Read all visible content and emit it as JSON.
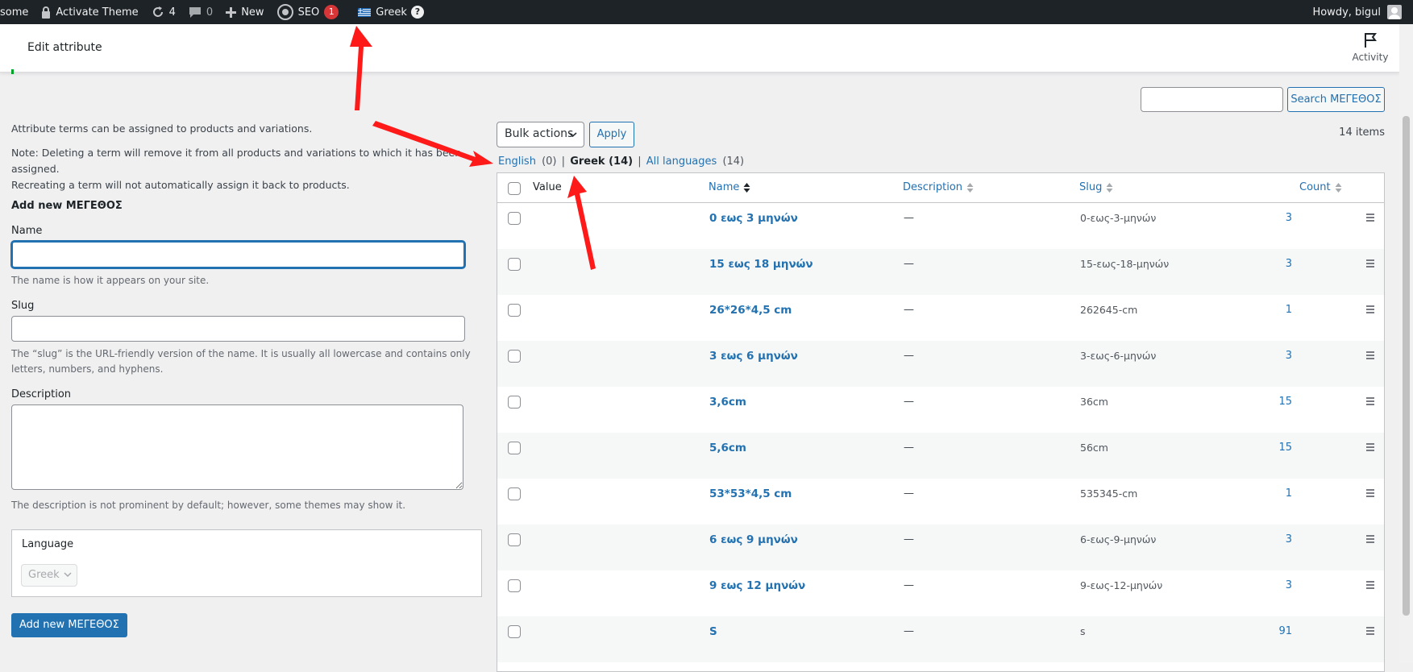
{
  "adminbar": {
    "site_label": "some",
    "activate_theme": "Activate Theme",
    "updates_count": "4",
    "comments_count": "0",
    "new_label": "New",
    "seo_label": "SEO",
    "seo_badge": "1",
    "language_label": "Greek",
    "language_help": "?",
    "howdy": "Howdy, bigul"
  },
  "header": {
    "title": "Edit attribute",
    "activity_label": "Activity"
  },
  "form": {
    "intro": "Attribute terms can be assigned to products and variations.",
    "note_line1": "Note: Deleting a term will remove it from all products and variations to which it has been assigned.",
    "note_line2": "Recreating a term will not automatically assign it back to products.",
    "title": "Add new ΜΕΓΕΘΟΣ",
    "name_label": "Name",
    "name_hint": "The name is how it appears on your site.",
    "slug_label": "Slug",
    "slug_hint_line1": "The “slug” is the URL-friendly version of the name. It is usually all lowercase and contains only",
    "slug_hint_line2": "letters, numbers, and hyphens.",
    "description_label": "Description",
    "description_hint": "The description is not prominent by default; however, some themes may show it.",
    "language_label": "Language",
    "language_value": "Greek",
    "submit_label": "Add new ΜΕΓΕΘΟΣ"
  },
  "list": {
    "search_button": "Search ΜΕΓΕΘΟΣ",
    "bulk_actions": "Bulk actions",
    "apply": "Apply",
    "items_count": "14 items",
    "filters": {
      "english": "English",
      "english_count": "(0)",
      "greek": "Greek",
      "greek_count": "(14)",
      "all": "All languages",
      "all_count": "(14)",
      "sep": "|"
    },
    "columns": {
      "value": "Value",
      "name": "Name",
      "description": "Description",
      "slug": "Slug",
      "count": "Count"
    },
    "rows": [
      {
        "name": "0 εως 3 μηνών",
        "desc": "—",
        "slug": "0-εως-3-μηνών",
        "count": "3"
      },
      {
        "name": "15 εως 18 μηνών",
        "desc": "—",
        "slug": "15-εως-18-μηνών",
        "count": "3"
      },
      {
        "name": "26*26*4,5 cm",
        "desc": "—",
        "slug": "262645-cm",
        "count": "1"
      },
      {
        "name": "3 εως 6 μηνών",
        "desc": "—",
        "slug": "3-εως-6-μηνών",
        "count": "3"
      },
      {
        "name": "3,6cm",
        "desc": "—",
        "slug": "36cm",
        "count": "15"
      },
      {
        "name": "5,6cm",
        "desc": "—",
        "slug": "56cm",
        "count": "15"
      },
      {
        "name": "53*53*4,5 cm",
        "desc": "—",
        "slug": "535345-cm",
        "count": "1"
      },
      {
        "name": "6 εως 9 μηνών",
        "desc": "—",
        "slug": "6-εως-9-μηνών",
        "count": "3"
      },
      {
        "name": "9 εως 12 μηνών",
        "desc": "—",
        "slug": "9-εως-12-μηνών",
        "count": "3"
      },
      {
        "name": "S",
        "desc": "—",
        "slug": "s",
        "count": "91"
      }
    ]
  },
  "colors": {
    "accent": "#2271b1",
    "annotation_arrow": "#ff1a1a",
    "admin_bar": "#1d2327",
    "badge": "#d63638"
  },
  "icons": [
    "lock-icon",
    "updates-icon",
    "comments-icon",
    "plus-icon",
    "seo-gear-icon",
    "greek-flag-icon",
    "help-icon",
    "avatar-icon",
    "flag-icon",
    "chevron-down-icon",
    "sort-icon",
    "drag-handle-icon",
    "red-annotation-arrow"
  ]
}
